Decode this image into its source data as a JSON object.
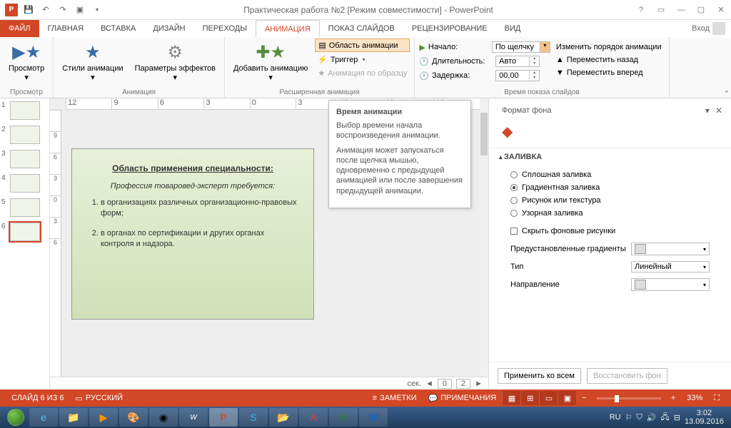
{
  "titlebar": {
    "title": "Практическая работа №2 [Режим совместимости] - PowerPoint"
  },
  "tabs": {
    "file": "ФАЙЛ",
    "home": "ГЛАВНАЯ",
    "insert": "ВСТАВКА",
    "design": "ДИЗАЙН",
    "transitions": "ПЕРЕХОДЫ",
    "animations": "АНИМАЦИЯ",
    "slideshow": "ПОКАЗ СЛАЙДОВ",
    "review": "РЕЦЕНЗИРОВАНИЕ",
    "view": "ВИД",
    "login": "Вход"
  },
  "ribbon": {
    "preview": "Просмотр",
    "preview_group": "Просмотр",
    "anim_styles": "Стили анимации",
    "effect_params": "Параметры эффектов",
    "anim_group": "Анимация",
    "add_anim": "Добавить анимацию",
    "anim_pane": "Область анимации",
    "trigger": "Триггер",
    "anim_painter": "Анимация по образцу",
    "adv_anim_group": "Расширенная анимация",
    "start_label": "Начало:",
    "start_value": "По щелчку",
    "duration_label": "Длительность:",
    "duration_value": "Авто",
    "delay_label": "Задержка:",
    "delay_value": "00,00",
    "timing_group": "Время показа слайдов",
    "reorder": "Изменить порядок анимации",
    "move_back": "Переместить назад",
    "move_fwd": "Переместить вперед"
  },
  "ruler_h": [
    "12",
    "9",
    "6",
    "3",
    "0",
    "3",
    "6",
    "9",
    "12"
  ],
  "ruler_v": [
    "",
    "9",
    "6",
    "3",
    "0",
    "3",
    "6"
  ],
  "slide": {
    "title": "Область применения специальности:",
    "sub": "Профессия товаровед-эксперт требуется:",
    "li1": "в организациях различных организационно-правовых форм;",
    "li2": "в органах по сертификации и других органах контроля и надзора.",
    "tag1": "1",
    "tag2": "2",
    "tag5": "5"
  },
  "tooltip": {
    "title": "Время анимации",
    "p1": "Выбор времени начала воспроизведения анимации.",
    "p2": "Анимация может запускаться после щелчка мышью, одновременно с предыдущей анимацией или после завершения предыдущей анимации."
  },
  "anim_strip": {
    "sec": "сек.",
    "n0": "0",
    "n2": "2"
  },
  "pane": {
    "title": "Формат фона",
    "fill": "ЗАЛИВКА",
    "solid": "Сплошная заливка",
    "gradient": "Градиентная заливка",
    "picture": "Рисунок или текстура",
    "pattern": "Узорная заливка",
    "hide_bg": "Скрыть фоновые рисунки",
    "preset": "Предустановленные градиенты",
    "type": "Тип",
    "type_value": "Линейный",
    "direction": "Направление",
    "apply_all": "Применить ко всем",
    "restore": "Восстановить фон"
  },
  "status": {
    "slide": "СЛАЙД 6 ИЗ 6",
    "lang": "РУССКИЙ",
    "notes": "ЗАМЕТКИ",
    "comments": "ПРИМЕЧАНИЯ",
    "zoom": "33%"
  },
  "taskbar": {
    "lang": "RU",
    "time": "3:02",
    "date": "13.09.2016"
  }
}
